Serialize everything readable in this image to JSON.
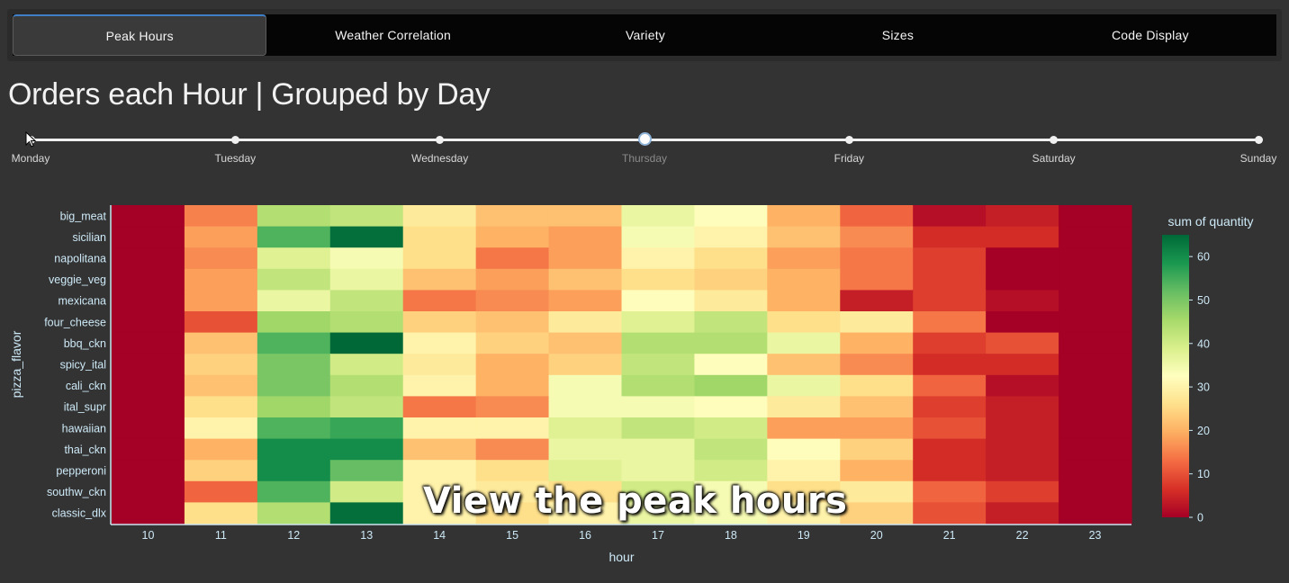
{
  "tabs": [
    {
      "label": "Peak Hours",
      "active": true
    },
    {
      "label": "Weather Correlation",
      "active": false
    },
    {
      "label": "Variety",
      "active": false
    },
    {
      "label": "Sizes",
      "active": false
    },
    {
      "label": "Code Display",
      "active": false
    }
  ],
  "page_title": "Orders each Hour | Grouped by Day",
  "day_slider": {
    "days": [
      "Monday",
      "Tuesday",
      "Wednesday",
      "Thursday",
      "Friday",
      "Saturday",
      "Sunday"
    ],
    "selected": "Thursday"
  },
  "overlay_caption": "View the peak hours",
  "chart_data": {
    "type": "heatmap",
    "xlabel": "hour",
    "ylabel": "pizza_flavor",
    "colorbar_title": "sum of quantity",
    "colorscale": "RdYlGn",
    "zlim": [
      0,
      65
    ],
    "colorbar_ticks": [
      0,
      10,
      20,
      30,
      40,
      50,
      60
    ],
    "x": [
      10,
      11,
      12,
      13,
      14,
      15,
      16,
      17,
      18,
      19,
      20,
      21,
      22,
      23
    ],
    "y": [
      "big_meat",
      "sicilian",
      "napolitana",
      "veggie_veg",
      "mexicana",
      "four_cheese",
      "bbq_ckn",
      "spicy_ital",
      "cali_ckn",
      "ital_supr",
      "hawaiian",
      "thai_ckn",
      "pepperoni",
      "southw_ckn",
      "classic_dlx"
    ],
    "z": [
      [
        0,
        15,
        44,
        42,
        28,
        22,
        22,
        36,
        32,
        20,
        12,
        2,
        4,
        0
      ],
      [
        0,
        18,
        54,
        64,
        26,
        20,
        18,
        34,
        30,
        22,
        16,
        6,
        6,
        0
      ],
      [
        0,
        16,
        38,
        34,
        26,
        14,
        18,
        30,
        26,
        18,
        14,
        8,
        0,
        0
      ],
      [
        0,
        18,
        42,
        36,
        22,
        18,
        22,
        26,
        24,
        20,
        14,
        8,
        0,
        0
      ],
      [
        0,
        18,
        36,
        42,
        14,
        16,
        18,
        32,
        28,
        20,
        4,
        8,
        2,
        0
      ],
      [
        0,
        10,
        46,
        44,
        24,
        22,
        28,
        38,
        42,
        26,
        28,
        14,
        0,
        0
      ],
      [
        0,
        22,
        54,
        66,
        30,
        24,
        22,
        44,
        44,
        36,
        20,
        8,
        10,
        0
      ],
      [
        0,
        24,
        50,
        40,
        28,
        20,
        24,
        42,
        32,
        22,
        16,
        6,
        6,
        0
      ],
      [
        0,
        22,
        50,
        44,
        30,
        20,
        34,
        44,
        46,
        36,
        26,
        12,
        2,
        0
      ],
      [
        0,
        26,
        46,
        42,
        14,
        16,
        34,
        34,
        32,
        28,
        22,
        8,
        4,
        0
      ],
      [
        0,
        30,
        54,
        56,
        30,
        30,
        38,
        42,
        40,
        18,
        18,
        10,
        4,
        0
      ],
      [
        0,
        20,
        60,
        60,
        22,
        16,
        36,
        36,
        42,
        32,
        24,
        6,
        4,
        0
      ],
      [
        0,
        24,
        60,
        52,
        30,
        26,
        38,
        36,
        40,
        30,
        20,
        6,
        4,
        0
      ],
      [
        0,
        12,
        54,
        40,
        30,
        28,
        26,
        40,
        34,
        26,
        28,
        12,
        8,
        0
      ],
      [
        0,
        26,
        44,
        64,
        30,
        26,
        30,
        36,
        34,
        30,
        24,
        10,
        4,
        0
      ]
    ]
  }
}
